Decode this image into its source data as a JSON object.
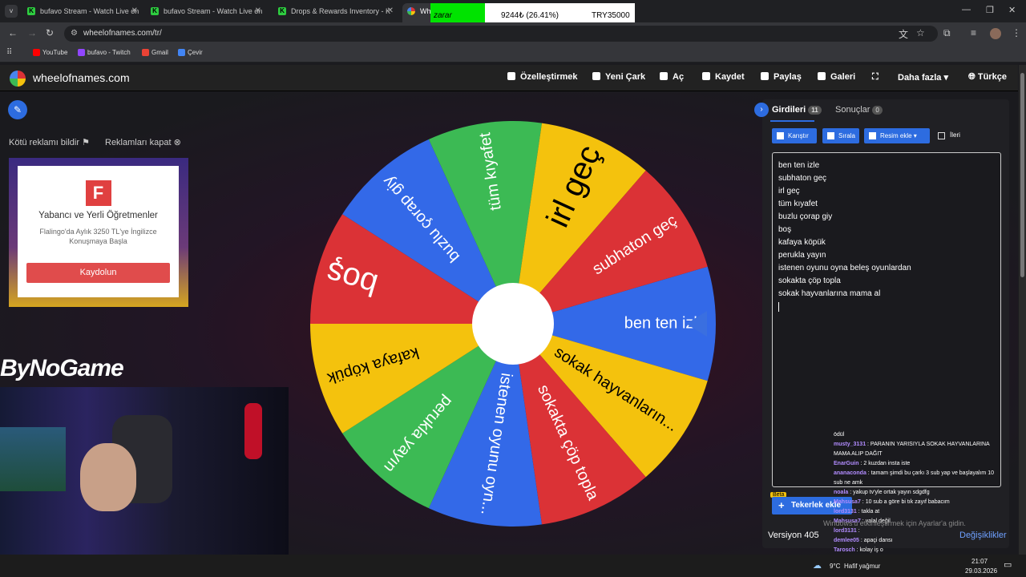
{
  "browser": {
    "tabs": [
      {
        "title": "bufavo Stream - Watch Live on"
      },
      {
        "title": "bufavo Stream - Watch Live on"
      },
      {
        "title": "Drops & Rewards Inventory - K"
      },
      {
        "title": "Whe"
      }
    ],
    "url": "wheelofnames.com/tr/",
    "bookmarks": [
      "YouTube",
      "bufavo - Twitch",
      "Gmail",
      "Çevir"
    ]
  },
  "overlay": {
    "label": "zarar",
    "value": "9244₺ (26.41%)",
    "target": "TRY35000"
  },
  "site": {
    "logo_text": "wheelofnames.com",
    "menu": [
      "Özelleştirmek",
      "Yeni Çark",
      "Aç",
      "Kaydet",
      "Paylaş",
      "Galeri",
      "Daha fazla",
      "Türkçe"
    ]
  },
  "ads": {
    "report": "Kötü reklamı bildir",
    "close": "Reklamları kapat",
    "logo_letter": "F",
    "title": "Yabancı ve Yerli Öğretmenler",
    "subtitle": "Flalingo'da Aylık 3250 TL'ye İngilizce Konuşmaya Başla",
    "cta": "Kaydolun"
  },
  "stream": {
    "brand": "ByNoGame"
  },
  "wheel": {
    "segments": [
      {
        "label": "ben ten izle",
        "color": "#3369e8"
      },
      {
        "label": "sokak hayvanların...",
        "color": "#f4c20d"
      },
      {
        "label": "sokakta çöp topla",
        "color": "#db3236"
      },
      {
        "label": "istenen oyunu oyn...",
        "color": "#3369e8"
      },
      {
        "label": "perukla yayın",
        "color": "#3cba54"
      },
      {
        "label": "kafaya köpük",
        "color": "#f4c20d"
      },
      {
        "label": "boş",
        "color": "#db3236"
      },
      {
        "label": "buzlu çorap giy",
        "color": "#3369e8"
      },
      {
        "label": "tüm kıyafet",
        "color": "#3cba54"
      },
      {
        "label": "irl geç",
        "color": "#f4c20d"
      },
      {
        "label": "subhaton geç",
        "color": "#db3236"
      }
    ]
  },
  "panel": {
    "tab_entries": "Girdileri",
    "entries_count": "11",
    "tab_results": "Sonuçlar",
    "results_count": "0",
    "buttons": [
      "Karıştır",
      "Sırala",
      "Resim ekle"
    ],
    "advanced": "İleri",
    "entries": [
      "ben ten izle",
      "subhaton geç",
      "irl geç",
      "tüm kıyafet",
      "buzlu çorap giy",
      "boş",
      "kafaya köpük",
      "perukla yayın",
      "istenen oyunu oyna beleş oyunlardan",
      "sokakta çöp topla",
      "sokak hayvanlarına mama al"
    ],
    "beta": "Beta",
    "add_wheel": "Tekerlek ekle",
    "version": "Versiyon 405",
    "changes": "Değişiklikler"
  },
  "chat": [
    {
      "user": "",
      "msg": "ödül"
    },
    {
      "user": "musty_3131",
      "msg": ": PARANIN YARISIYLA SOKAK HAYVANLARINA"
    },
    {
      "user": "",
      "msg": "MAMA ALIP DAĞIT"
    },
    {
      "user": "EnarGuin",
      "msg": ": 2 kuzdan insta iste"
    },
    {
      "user": "ananaconda",
      "msg": ": tamam şimdi bu çarkı 3 sub yap ve başlayalım 10"
    },
    {
      "user": "",
      "msg": "sub ne amk"
    },
    {
      "user": "noala",
      "msg": ": yakup tv'yle ortak yayın sdgdfg"
    },
    {
      "user": "Mahsusa7",
      "msg": ": 10 sub a göre bi tık zayıf babacım"
    },
    {
      "user": "lord3131",
      "msg": ": takla at"
    },
    {
      "user": "Mahsusa7",
      "msg": ": valal değil"
    },
    {
      "user": "lord3131",
      "msg": ":"
    },
    {
      "user": "demlee05",
      "msg": ": apaçi dansı"
    },
    {
      "user": "Tarosch",
      "msg": ": kolay iş o"
    }
  ],
  "windows_msg": "Windows'u etkinleştirmek için Ayarlar'a gidin.",
  "taskbar": {
    "weather": "9°C",
    "weather_desc": "Hafif yağmur",
    "time": "21:07",
    "date": "29.03.2026"
  }
}
